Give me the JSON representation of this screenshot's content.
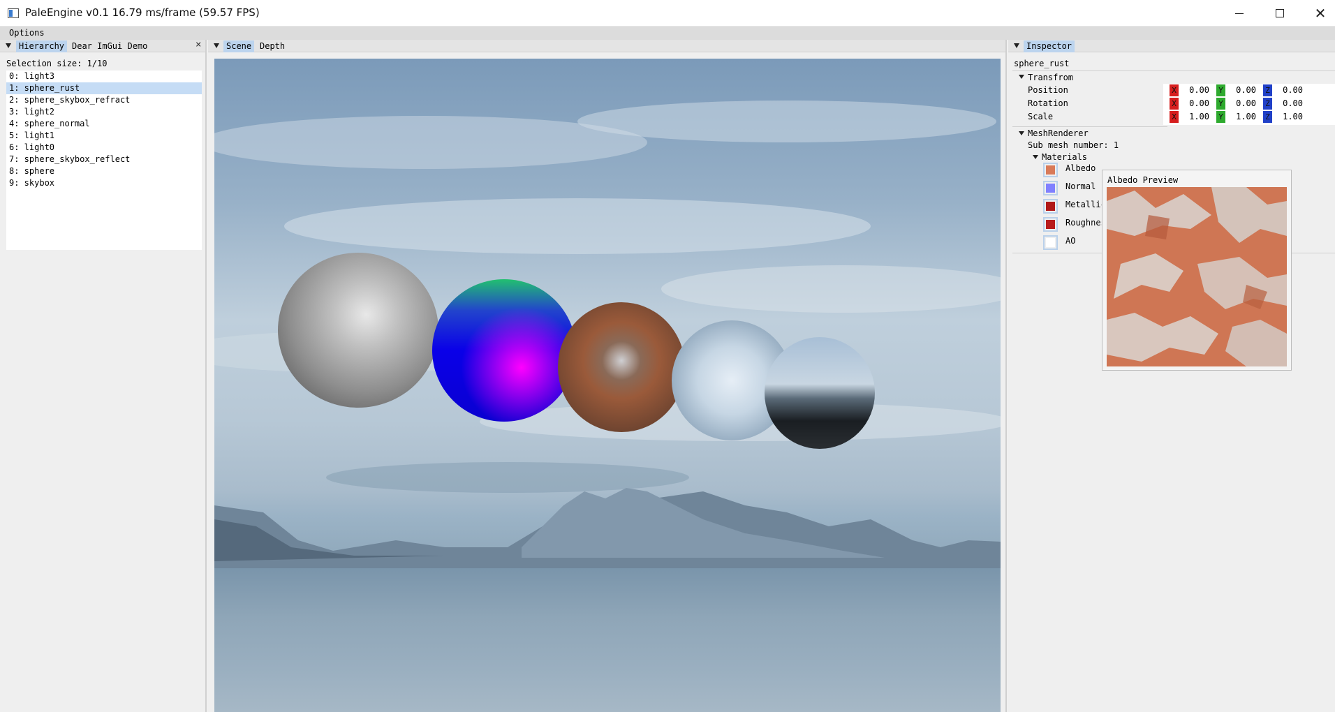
{
  "window": {
    "title": "PaleEngine v0.1 16.79 ms/frame (59.57 FPS)"
  },
  "menu": {
    "options": "Options"
  },
  "hierarchy": {
    "tabs": [
      "Hierarchy",
      "Dear ImGui Demo"
    ],
    "close": "×",
    "selection_size": "Selection size: 1/10",
    "items": [
      "0: light3",
      "1: sphere_rust",
      "2: sphere_skybox_refract",
      "3: light2",
      "4: sphere_normal",
      "5: light1",
      "6: light0",
      "7: sphere_skybox_reflect",
      "8: sphere",
      "9: skybox"
    ],
    "selected_index": 1
  },
  "scene": {
    "tabs": [
      "Scene",
      "Depth"
    ]
  },
  "inspector": {
    "tab": "Inspector",
    "object_name": "sphere_rust",
    "transform": {
      "header": "Transfrom",
      "rows": [
        {
          "label": "Position",
          "x": "0.00",
          "y": "0.00",
          "z": "0.00"
        },
        {
          "label": "Rotation",
          "x": "0.00",
          "y": "0.00",
          "z": "0.00"
        },
        {
          "label": "Scale",
          "x": "1.00",
          "y": "1.00",
          "z": "1.00"
        }
      ],
      "axis_labels": {
        "x": "X",
        "y": "Y",
        "z": "Z"
      }
    },
    "mesh_renderer": {
      "header": "MeshRenderer",
      "sub_mesh": "Sub mesh number: 1",
      "materials_header": "Materials",
      "materials": [
        {
          "label": "Albedo",
          "color": "#d97a58"
        },
        {
          "label": "Normal",
          "color": "#8080ff"
        },
        {
          "label": "Metallic",
          "color": "#b01818"
        },
        {
          "label": "Roughness",
          "color": "#b81c1c"
        },
        {
          "label": "AO",
          "color": "#ffffff"
        }
      ]
    },
    "preview": {
      "title": "Albedo Preview"
    }
  },
  "colors": {
    "tab_active": "#bcd4ee",
    "selection": "#c5dcf5",
    "axis_x": "#d61e1e",
    "axis_y": "#2eaa2e",
    "axis_z": "#2040c8"
  }
}
